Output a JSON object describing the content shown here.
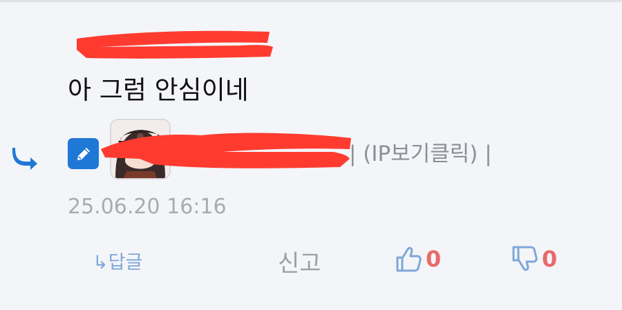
{
  "comment": {
    "text": "아 그럼 안심이네",
    "meta_suffix": "| (IP보기클릭) |",
    "timestamp": "25.06.20 16:16"
  },
  "actions": {
    "reply_label": "↳답글",
    "report_label": "신고",
    "like_count": "0",
    "dislike_count": "0"
  },
  "colors": {
    "background": "#f4f5f9",
    "edit_badge": "#1f78d6",
    "reply_arrow": "#1f78d6",
    "redaction": "#ff3b30",
    "vote_count": "#e86a6a",
    "thumb_icon": "#7ea7d8"
  },
  "icons": {
    "reply_indicator": "reply-arrow-icon",
    "edit_badge": "pencil-icon",
    "like": "thumbs-up-icon",
    "dislike": "thumbs-down-icon"
  }
}
